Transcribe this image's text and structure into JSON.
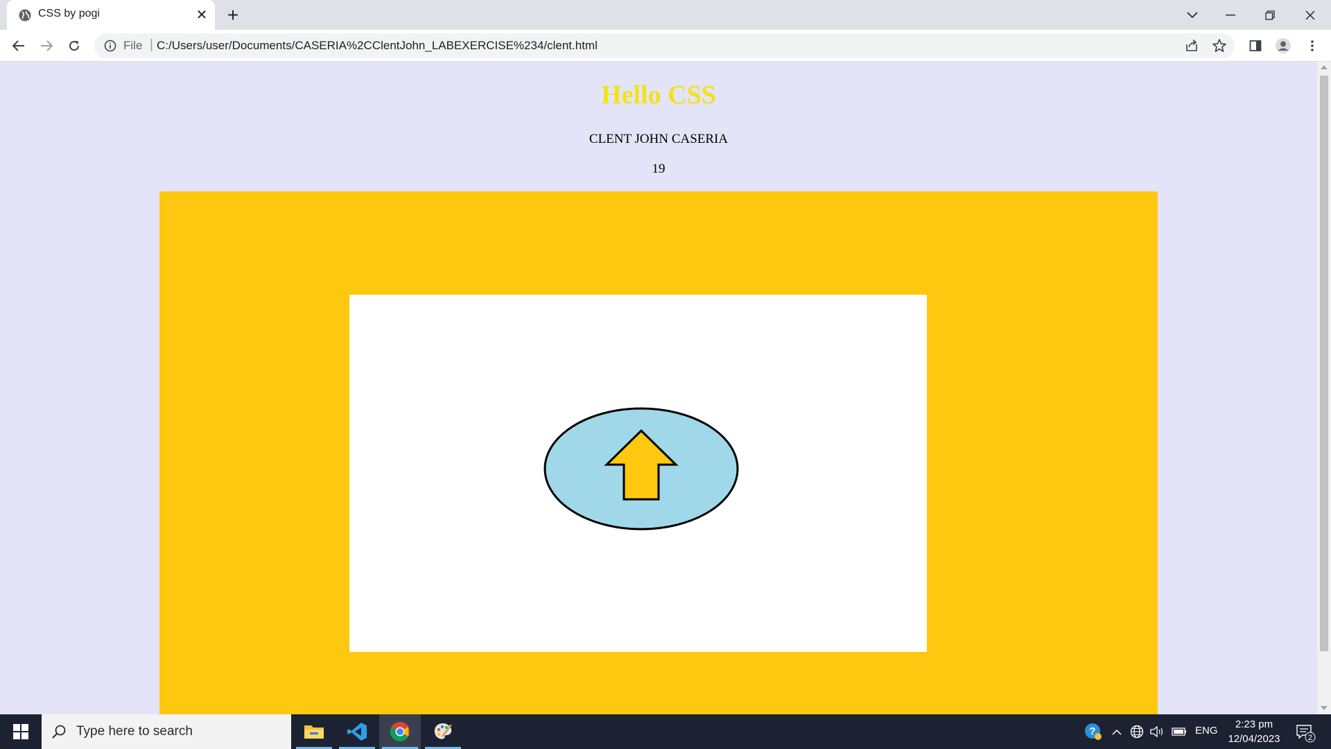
{
  "browser": {
    "tab_title": "CSS by pogi",
    "address_scheme": "File",
    "address_url": "C:/Users/user/Documents/CASERIA%2CClentJohn_LABEXERCISE%234/clent.html"
  },
  "page": {
    "heading": "Hello CSS",
    "name": "CLENT JOHN CASERIA",
    "age": "19",
    "colors": {
      "background": "#e3e4f7",
      "heading": "#f2e21b",
      "outer_box": "#fdc80f",
      "inner_box": "#ffffff",
      "button_fill": "#a0d8ea",
      "arrow_fill": "#fdc80f"
    },
    "upload_button_icon": "up-arrow-icon"
  },
  "taskbar": {
    "search_placeholder": "Type here to search",
    "language": "ENG",
    "time": "2:23 pm",
    "date": "12/04/2023",
    "notification_count": "2"
  }
}
